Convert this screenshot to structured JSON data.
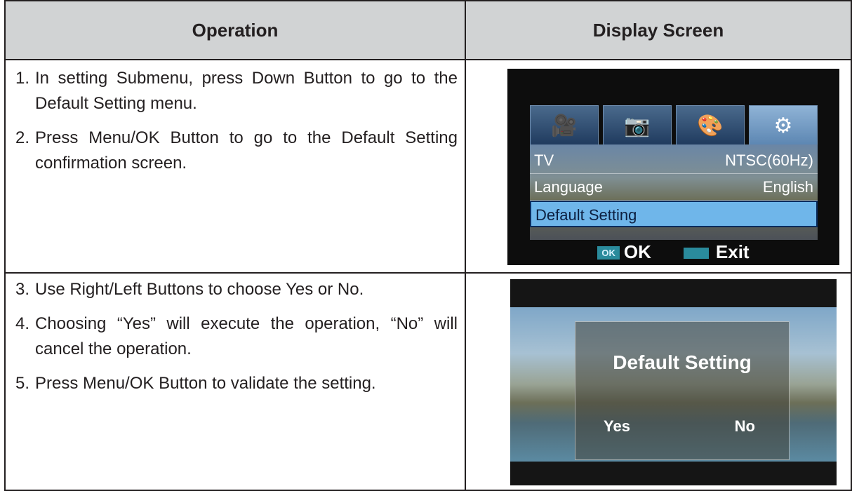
{
  "table": {
    "headers": {
      "operation": "Operation",
      "display": "Display Screen"
    },
    "rows": [
      {
        "steps": [
          {
            "num": "1.",
            "text": "In setting Submenu, press Down Button to go to the Default Setting menu."
          },
          {
            "num": "2.",
            "text": "Press Menu/OK Button to go to the Default Setting confirmation screen."
          }
        ]
      },
      {
        "steps": [
          {
            "num": "3.",
            "text": "Use Right/Left Buttons to choose Yes or No."
          },
          {
            "num": "4.",
            "text": "Choosing “Yes” will execute the operation, “No” will cancel the operation."
          },
          {
            "num": "5.",
            "text": "Press Menu/OK Button to validate the setting."
          }
        ]
      }
    ]
  },
  "screen1": {
    "tabs": [
      {
        "icon": "video-icon",
        "glyph": "🎥"
      },
      {
        "icon": "camera-icon",
        "glyph": "📷"
      },
      {
        "icon": "effect-icon",
        "glyph": "🎨"
      },
      {
        "icon": "settings-gear-icon",
        "glyph": "⚙"
      }
    ],
    "menu": [
      {
        "label": "TV",
        "value": "NTSC(60Hz)"
      },
      {
        "label": "Language",
        "value": "English"
      },
      {
        "label": "Default Setting",
        "value": ""
      }
    ],
    "ok_badge": "OK",
    "ok_label": "OK",
    "exit_label": "Exit"
  },
  "screen2": {
    "title": "Default Setting",
    "yes": "Yes",
    "no": "No"
  }
}
